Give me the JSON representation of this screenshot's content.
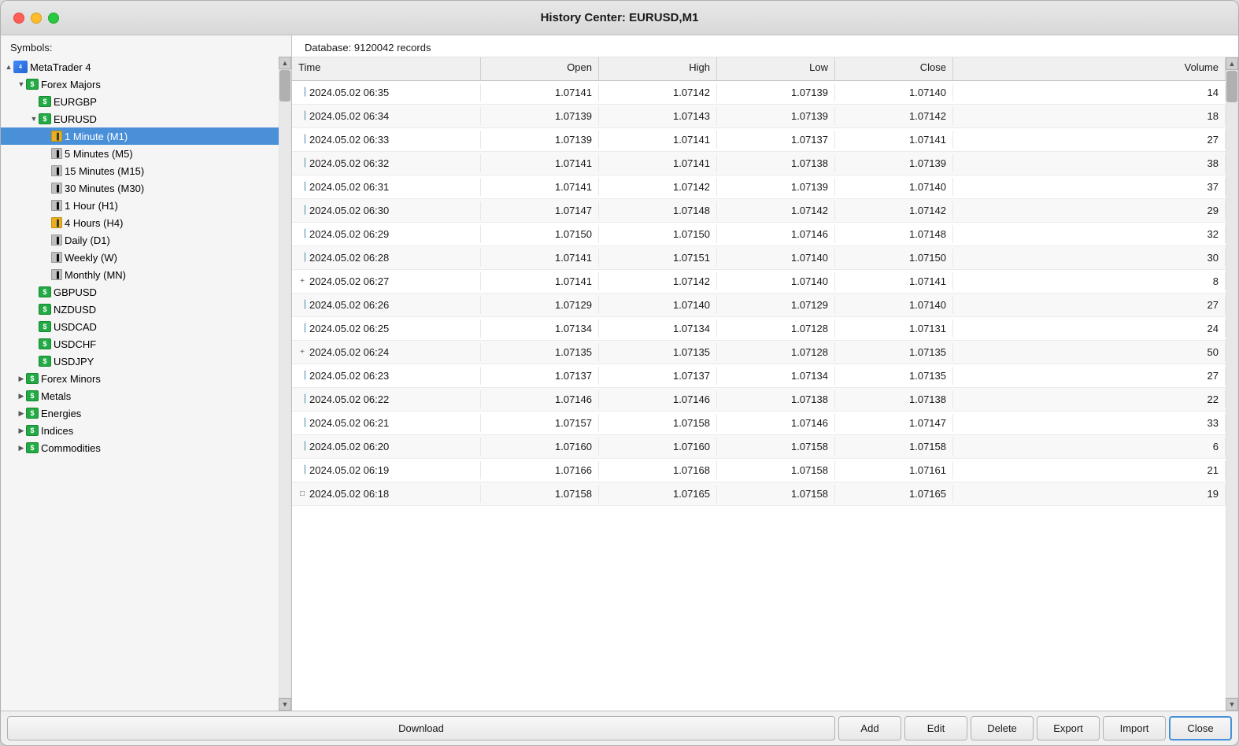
{
  "window": {
    "title": "History Center: EURUSD,M1"
  },
  "sidebar": {
    "label": "Symbols:",
    "tree": [
      {
        "id": "mt4",
        "label": "MetaTrader 4",
        "level": 0,
        "type": "mt4",
        "expanded": true,
        "expandIcon": "▲"
      },
      {
        "id": "forex-majors",
        "label": "Forex Majors",
        "level": 1,
        "type": "folder-green",
        "expanded": true,
        "expandIcon": "▼"
      },
      {
        "id": "eurgbp",
        "label": "EURGBP",
        "level": 2,
        "type": "dollar-green",
        "expandIcon": ""
      },
      {
        "id": "eurusd",
        "label": "EURUSD",
        "level": 2,
        "type": "dollar-green",
        "expanded": true,
        "expandIcon": "▼"
      },
      {
        "id": "m1",
        "label": "1 Minute (M1)",
        "level": 3,
        "type": "candle-yellow",
        "selected": true,
        "expandIcon": ""
      },
      {
        "id": "m5",
        "label": "5 Minutes (M5)",
        "level": 3,
        "type": "candle-gray",
        "expandIcon": ""
      },
      {
        "id": "m15",
        "label": "15 Minutes (M15)",
        "level": 3,
        "type": "candle-gray",
        "expandIcon": ""
      },
      {
        "id": "m30",
        "label": "30 Minutes (M30)",
        "level": 3,
        "type": "candle-gray",
        "expandIcon": ""
      },
      {
        "id": "h1",
        "label": "1 Hour (H1)",
        "level": 3,
        "type": "candle-gray",
        "expandIcon": ""
      },
      {
        "id": "h4",
        "label": "4 Hours (H4)",
        "level": 3,
        "type": "candle-yellow",
        "expandIcon": ""
      },
      {
        "id": "d1",
        "label": "Daily (D1)",
        "level": 3,
        "type": "candle-gray",
        "expandIcon": ""
      },
      {
        "id": "w",
        "label": "Weekly (W)",
        "level": 3,
        "type": "candle-gray",
        "expandIcon": ""
      },
      {
        "id": "mn",
        "label": "Monthly (MN)",
        "level": 3,
        "type": "candle-gray",
        "expandIcon": ""
      },
      {
        "id": "gbpusd",
        "label": "GBPUSD",
        "level": 2,
        "type": "dollar-green",
        "expandIcon": ""
      },
      {
        "id": "nzdusd",
        "label": "NZDUSD",
        "level": 2,
        "type": "dollar-green",
        "expandIcon": ""
      },
      {
        "id": "usdcad",
        "label": "USDCAD",
        "level": 2,
        "type": "dollar-green",
        "expandIcon": ""
      },
      {
        "id": "usdchf",
        "label": "USDCHF",
        "level": 2,
        "type": "dollar-green",
        "expandIcon": ""
      },
      {
        "id": "usdjpy",
        "label": "USDJPY",
        "level": 2,
        "type": "dollar-green",
        "expandIcon": ""
      },
      {
        "id": "forex-minors",
        "label": "Forex Minors",
        "level": 1,
        "type": "folder-green",
        "expanded": false,
        "expandIcon": "▶"
      },
      {
        "id": "metals",
        "label": "Metals",
        "level": 1,
        "type": "folder-green",
        "expanded": false,
        "expandIcon": "▶"
      },
      {
        "id": "energies",
        "label": "Energies",
        "level": 1,
        "type": "folder-green",
        "expanded": false,
        "expandIcon": "▶"
      },
      {
        "id": "indices",
        "label": "Indices",
        "level": 1,
        "type": "folder-green",
        "expanded": false,
        "expandIcon": "▶"
      },
      {
        "id": "commodities",
        "label": "Commodities",
        "level": 1,
        "type": "folder-green",
        "expanded": false,
        "expandIcon": "▶"
      }
    ]
  },
  "main": {
    "db_info": "Database: 9120042 records",
    "columns": {
      "time": "Time",
      "open": "Open",
      "high": "High",
      "low": "Low",
      "close": "Close",
      "volume": "Volume"
    },
    "rows": [
      {
        "time": "2024.05.02 06:35",
        "open": "1.07141",
        "high": "1.07142",
        "low": "1.07139",
        "close": "1.07140",
        "volume": "14",
        "icon": "candle"
      },
      {
        "time": "2024.05.02 06:34",
        "open": "1.07139",
        "high": "1.07143",
        "low": "1.07139",
        "close": "1.07142",
        "volume": "18",
        "icon": "candle"
      },
      {
        "time": "2024.05.02 06:33",
        "open": "1.07139",
        "high": "1.07141",
        "low": "1.07137",
        "close": "1.07141",
        "volume": "27",
        "icon": "candle"
      },
      {
        "time": "2024.05.02 06:32",
        "open": "1.07141",
        "high": "1.07141",
        "low": "1.07138",
        "close": "1.07139",
        "volume": "38",
        "icon": "candle"
      },
      {
        "time": "2024.05.02 06:31",
        "open": "1.07141",
        "high": "1.07142",
        "low": "1.07139",
        "close": "1.07140",
        "volume": "37",
        "icon": "candle"
      },
      {
        "time": "2024.05.02 06:30",
        "open": "1.07147",
        "high": "1.07148",
        "low": "1.07142",
        "close": "1.07142",
        "volume": "29",
        "icon": "candle"
      },
      {
        "time": "2024.05.02 06:29",
        "open": "1.07150",
        "high": "1.07150",
        "low": "1.07146",
        "close": "1.07148",
        "volume": "32",
        "icon": "candle"
      },
      {
        "time": "2024.05.02 06:28",
        "open": "1.07141",
        "high": "1.07151",
        "low": "1.07140",
        "close": "1.07150",
        "volume": "30",
        "icon": "candle"
      },
      {
        "time": "2024.05.02 06:27",
        "open": "1.07141",
        "high": "1.07142",
        "low": "1.07140",
        "close": "1.07141",
        "volume": "8",
        "icon": "cross"
      },
      {
        "time": "2024.05.02 06:26",
        "open": "1.07129",
        "high": "1.07140",
        "low": "1.07129",
        "close": "1.07140",
        "volume": "27",
        "icon": "candle"
      },
      {
        "time": "2024.05.02 06:25",
        "open": "1.07134",
        "high": "1.07134",
        "low": "1.07128",
        "close": "1.07131",
        "volume": "24",
        "icon": "candle"
      },
      {
        "time": "2024.05.02 06:24",
        "open": "1.07135",
        "high": "1.07135",
        "low": "1.07128",
        "close": "1.07135",
        "volume": "50",
        "icon": "cross"
      },
      {
        "time": "2024.05.02 06:23",
        "open": "1.07137",
        "high": "1.07137",
        "low": "1.07134",
        "close": "1.07135",
        "volume": "27",
        "icon": "candle"
      },
      {
        "time": "2024.05.02 06:22",
        "open": "1.07146",
        "high": "1.07146",
        "low": "1.07138",
        "close": "1.07138",
        "volume": "22",
        "icon": "candle"
      },
      {
        "time": "2024.05.02 06:21",
        "open": "1.07157",
        "high": "1.07158",
        "low": "1.07146",
        "close": "1.07147",
        "volume": "33",
        "icon": "candle"
      },
      {
        "time": "2024.05.02 06:20",
        "open": "1.07160",
        "high": "1.07160",
        "low": "1.07158",
        "close": "1.07158",
        "volume": "6",
        "icon": "candle"
      },
      {
        "time": "2024.05.02 06:19",
        "open": "1.07166",
        "high": "1.07168",
        "low": "1.07158",
        "close": "1.07161",
        "volume": "21",
        "icon": "candle"
      },
      {
        "time": "2024.05.02 06:18",
        "open": "1.07158",
        "high": "1.07165",
        "low": "1.07158",
        "close": "1.07165",
        "volume": "19",
        "icon": "candle-open"
      }
    ]
  },
  "buttons": {
    "download": "Download",
    "add": "Add",
    "edit": "Edit",
    "delete": "Delete",
    "export": "Export",
    "import": "Import",
    "close": "Close"
  }
}
